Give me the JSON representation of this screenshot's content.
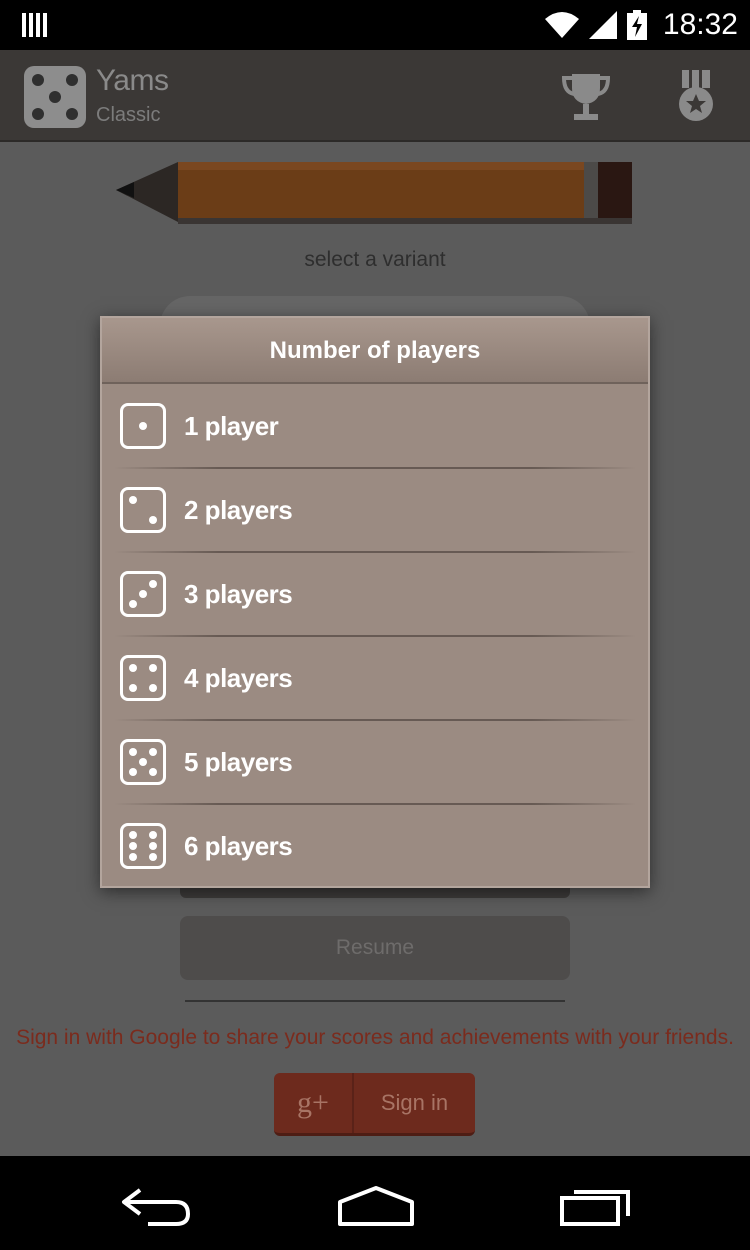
{
  "status_bar": {
    "time": "18:32",
    "icons": [
      "notification-bars-icon",
      "wifi-icon",
      "signal-icon",
      "battery-charging-icon"
    ]
  },
  "action_bar": {
    "title": "Yams",
    "subtitle": "Classic",
    "icons": [
      "dice-five-icon",
      "trophy-icon",
      "medal-icon"
    ]
  },
  "main": {
    "variant_label": "select a variant",
    "resume_label": "Resume",
    "signin_prompt": "Sign in with Google to share your scores and achievements with your friends.",
    "signin_gplus": "g+",
    "signin_label": "Sign in"
  },
  "dialog": {
    "title": "Number of players",
    "options": [
      {
        "label": "1 player",
        "pips": 1
      },
      {
        "label": "2 players",
        "pips": 2
      },
      {
        "label": "3 players",
        "pips": 3
      },
      {
        "label": "4 players",
        "pips": 4
      },
      {
        "label": "5 players",
        "pips": 5
      },
      {
        "label": "6 players",
        "pips": 6
      }
    ]
  },
  "nav_bar": {
    "icons": [
      "back-icon",
      "home-icon",
      "recent-apps-icon"
    ]
  },
  "colors": {
    "dialog_bg": "#9b8b82",
    "accent_red": "#7b2b1d",
    "overlay_bg": "#5b5b5b"
  }
}
